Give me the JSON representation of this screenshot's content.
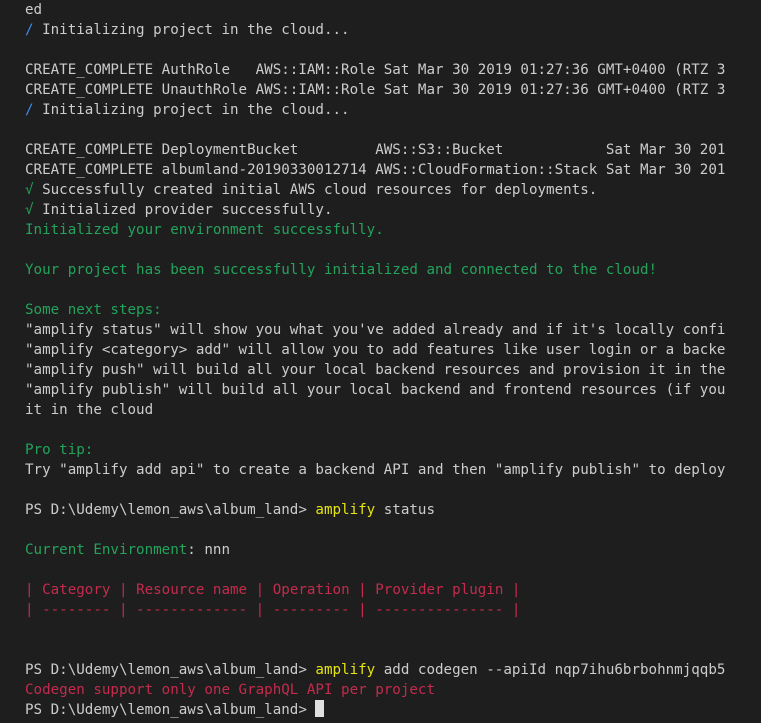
{
  "colors": {
    "background": "#1e1e1e",
    "default": "#cccccc",
    "green": "#23a35b",
    "yellow": "#e5e510",
    "red": "#c42b4d",
    "blue": "#3b8eea"
  },
  "lines": [
    {
      "segments": [
        {
          "text": "ed",
          "color": "default"
        }
      ]
    },
    {
      "segments": [
        {
          "text": "/ ",
          "color": "blue"
        },
        {
          "text": "Initializing project in the cloud...",
          "color": "default"
        }
      ]
    },
    {
      "segments": [
        {
          "text": "",
          "color": "default"
        }
      ]
    },
    {
      "segments": [
        {
          "text": "CREATE_COMPLETE AuthRole   AWS::IAM::Role Sat Mar 30 2019 01:27:36 GMT+0400 (RTZ 3",
          "color": "default"
        }
      ]
    },
    {
      "segments": [
        {
          "text": "CREATE_COMPLETE UnauthRole AWS::IAM::Role Sat Mar 30 2019 01:27:36 GMT+0400 (RTZ 3",
          "color": "default"
        }
      ]
    },
    {
      "segments": [
        {
          "text": "/ ",
          "color": "blue"
        },
        {
          "text": "Initializing project in the cloud...",
          "color": "default"
        }
      ]
    },
    {
      "segments": [
        {
          "text": "",
          "color": "default"
        }
      ]
    },
    {
      "segments": [
        {
          "text": "CREATE_COMPLETE DeploymentBucket         AWS::S3::Bucket            Sat Mar 30 201",
          "color": "default"
        }
      ]
    },
    {
      "segments": [
        {
          "text": "CREATE_COMPLETE albumland-20190330012714 AWS::CloudFormation::Stack Sat Mar 30 201",
          "color": "default"
        }
      ]
    },
    {
      "segments": [
        {
          "text": "√ ",
          "color": "green"
        },
        {
          "text": "Successfully created initial AWS cloud resources for deployments.",
          "color": "default"
        }
      ]
    },
    {
      "segments": [
        {
          "text": "√ ",
          "color": "green"
        },
        {
          "text": "Initialized provider successfully.",
          "color": "default"
        }
      ]
    },
    {
      "segments": [
        {
          "text": "Initialized your environment successfully.",
          "color": "green"
        }
      ]
    },
    {
      "segments": [
        {
          "text": "",
          "color": "default"
        }
      ]
    },
    {
      "segments": [
        {
          "text": "Your project has been successfully initialized and connected to the cloud!",
          "color": "green"
        }
      ]
    },
    {
      "segments": [
        {
          "text": "",
          "color": "default"
        }
      ]
    },
    {
      "segments": [
        {
          "text": "Some next steps:",
          "color": "green"
        }
      ]
    },
    {
      "segments": [
        {
          "text": "\"amplify status\" will show you what you've added already and if it's locally confi",
          "color": "default"
        }
      ]
    },
    {
      "segments": [
        {
          "text": "\"amplify <category> add\" will allow you to add features like user login or a backe",
          "color": "default"
        }
      ]
    },
    {
      "segments": [
        {
          "text": "\"amplify push\" will build all your local backend resources and provision it in the",
          "color": "default"
        }
      ]
    },
    {
      "segments": [
        {
          "text": "\"amplify publish\" will build all your local backend and frontend resources (if you",
          "color": "default"
        }
      ]
    },
    {
      "segments": [
        {
          "text": "it in the cloud",
          "color": "default"
        }
      ]
    },
    {
      "segments": [
        {
          "text": "",
          "color": "default"
        }
      ]
    },
    {
      "segments": [
        {
          "text": "Pro tip:",
          "color": "green"
        }
      ]
    },
    {
      "segments": [
        {
          "text": "Try \"amplify add api\" to create a backend API and then \"amplify publish\" to deploy",
          "color": "default"
        }
      ]
    },
    {
      "segments": [
        {
          "text": "",
          "color": "default"
        }
      ]
    },
    {
      "segments": [
        {
          "text": "PS D:\\Udemy\\lemon_aws\\album_land> ",
          "color": "default"
        },
        {
          "text": "amplify",
          "color": "yellow"
        },
        {
          "text": " status",
          "color": "default"
        }
      ]
    },
    {
      "segments": [
        {
          "text": "",
          "color": "default"
        }
      ]
    },
    {
      "segments": [
        {
          "text": "Current Environment",
          "color": "green"
        },
        {
          "text": ": nnn",
          "color": "default"
        }
      ]
    },
    {
      "segments": [
        {
          "text": "",
          "color": "default"
        }
      ]
    },
    {
      "segments": [
        {
          "text": "| ",
          "color": "red"
        },
        {
          "text": "Category",
          "color": "red"
        },
        {
          "text": " | ",
          "color": "red"
        },
        {
          "text": "Resource name",
          "color": "red"
        },
        {
          "text": " | ",
          "color": "red"
        },
        {
          "text": "Operation",
          "color": "red"
        },
        {
          "text": " | ",
          "color": "red"
        },
        {
          "text": "Provider plugin",
          "color": "red"
        },
        {
          "text": " |",
          "color": "red"
        }
      ]
    },
    {
      "segments": [
        {
          "text": "| -------- | ------------- | --------- | --------------- |",
          "color": "red"
        }
      ]
    },
    {
      "segments": [
        {
          "text": "",
          "color": "default"
        }
      ]
    },
    {
      "segments": [
        {
          "text": "",
          "color": "default"
        }
      ]
    },
    {
      "segments": [
        {
          "text": "PS D:\\Udemy\\lemon_aws\\album_land> ",
          "color": "default"
        },
        {
          "text": "amplify",
          "color": "yellow"
        },
        {
          "text": " add codegen --apiId nqp7ihu6brbohnmjqqb5",
          "color": "default"
        }
      ]
    },
    {
      "segments": [
        {
          "text": "Codegen support only one GraphQL API per project",
          "color": "red"
        }
      ]
    },
    {
      "segments": [
        {
          "text": "PS D:\\Udemy\\lemon_aws\\album_land> ",
          "color": "default"
        }
      ],
      "cursor": true
    }
  ]
}
